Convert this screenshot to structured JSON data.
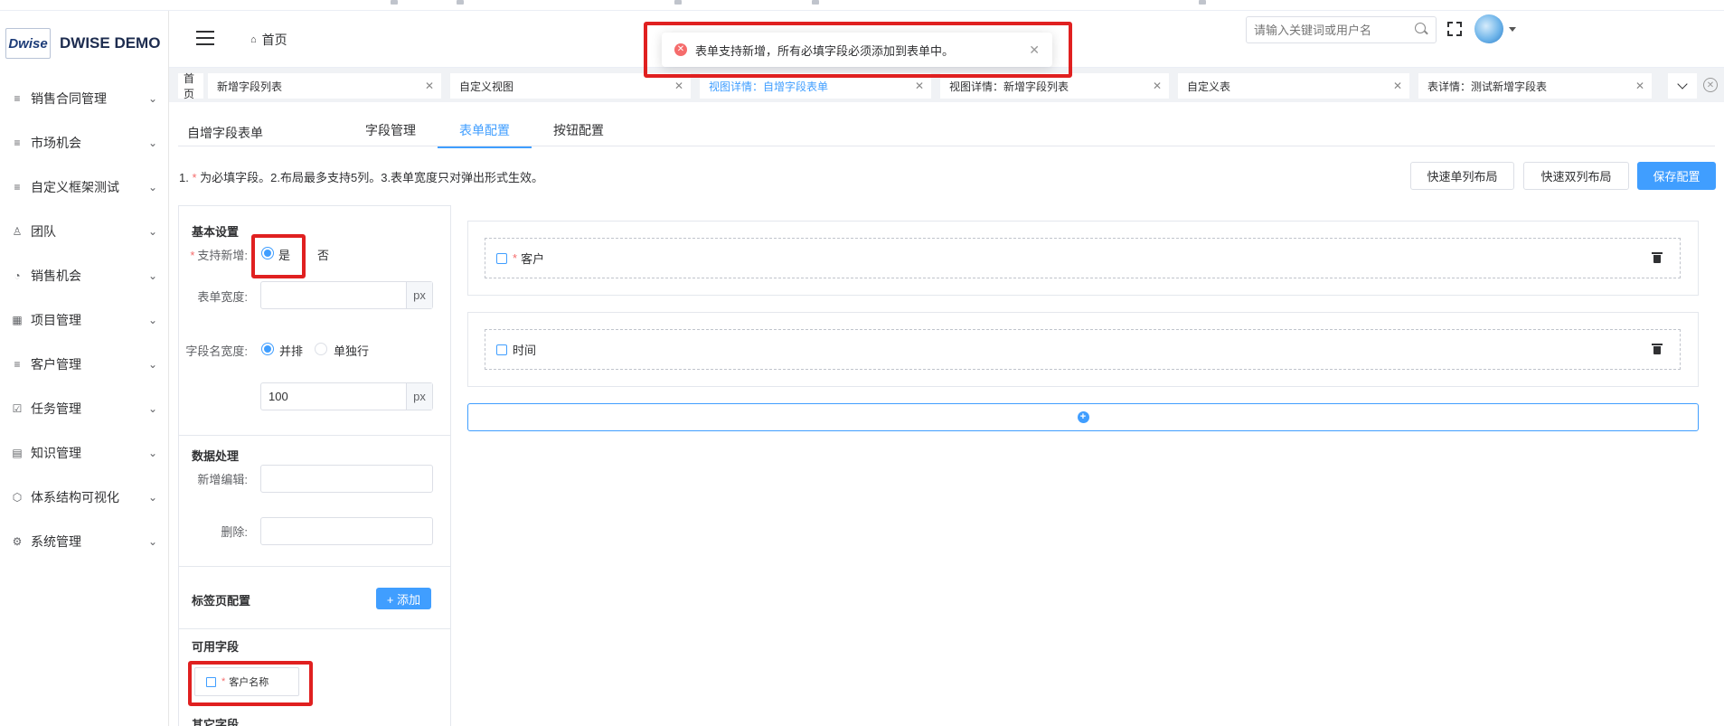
{
  "brand": {
    "logo_text": "Dwise",
    "name": "DWISE DEMO"
  },
  "sidebar": {
    "items": [
      {
        "icon": "list-icon",
        "glyph": "≡",
        "label": "销售合同管理"
      },
      {
        "icon": "list-icon",
        "glyph": "≡",
        "label": "市场机会"
      },
      {
        "icon": "list-icon",
        "glyph": "≡",
        "label": "自定义框架测试"
      },
      {
        "icon": "team-icon",
        "glyph": "♙",
        "label": "团队"
      },
      {
        "icon": "chart-pie-icon",
        "glyph": "◔",
        "label": "销售机会"
      },
      {
        "icon": "grid-icon",
        "glyph": "▦",
        "label": "项目管理"
      },
      {
        "icon": "list-icon",
        "glyph": "≡",
        "label": "客户管理"
      },
      {
        "icon": "task-icon",
        "glyph": "☑",
        "label": "任务管理"
      },
      {
        "icon": "book-icon",
        "glyph": "▤",
        "label": "知识管理"
      },
      {
        "icon": "structure-icon",
        "glyph": "⬡",
        "label": "体系结构可视化"
      },
      {
        "icon": "gear-icon",
        "glyph": "⚙",
        "label": "系统管理"
      }
    ]
  },
  "header": {
    "breadcrumb": "首页",
    "search_placeholder": "请输入关键词或用户名"
  },
  "toast": {
    "type": "error",
    "message": "表单支持新增，所有必填字段必须添加到表单中。"
  },
  "tabs": [
    {
      "label": "首页",
      "closable": false,
      "active": false
    },
    {
      "label": "新增字段列表",
      "closable": true,
      "active": false
    },
    {
      "label": "自定义视图",
      "closable": true,
      "active": false
    },
    {
      "label": "视图详情：自增字段表单",
      "closable": true,
      "active": true
    },
    {
      "label": "视图详情：新增字段列表",
      "closable": true,
      "active": false
    },
    {
      "label": "自定义表",
      "closable": true,
      "active": false
    },
    {
      "label": "表详情：测试新增字段表",
      "closable": true,
      "active": false
    }
  ],
  "page": {
    "title": "自增字段表单",
    "subtabs": [
      "字段管理",
      "表单配置",
      "按钮配置"
    ],
    "active_subtab": "表单配置",
    "hint_prefix": "1. ",
    "hint_star": "*",
    "hint_rest": " 为必填字段。2.布局最多支持5列。3.表单宽度只对弹出形式生效。",
    "buttons": {
      "single_layout": "快速单列布局",
      "double_layout": "快速双列布局",
      "save": "保存配置"
    }
  },
  "config": {
    "basic_title": "基本设置",
    "support_add_label": "支持新增:",
    "support_add_yes": "是",
    "support_add_no": "否",
    "support_add_value": "是",
    "form_width_label": "表单宽度:",
    "form_width_value": "",
    "unit_px": "px",
    "field_name_width_label": "字段名宽度:",
    "field_name_width_side": "并排",
    "field_name_width_single": "单独行",
    "field_name_width_mode": "并排",
    "field_name_width_value": "100",
    "data_title": "数据处理",
    "add_edit_label": "新增编辑:",
    "delete_label": "删除:",
    "tab_config_title": "标签页配置",
    "add_button": "+ 添加",
    "available_fields_title": "可用字段",
    "available_fields": [
      {
        "label": "客户名称",
        "required": true
      }
    ],
    "other_fields_title": "其它字段"
  },
  "form_rows": [
    {
      "label": "客户",
      "required": true,
      "icon": "relation-icon"
    },
    {
      "label": "时间",
      "required": false,
      "icon": "calendar-icon"
    }
  ],
  "colors": {
    "primary": "#409eff",
    "danger": "#f56c6c",
    "highlight": "#e02020"
  }
}
